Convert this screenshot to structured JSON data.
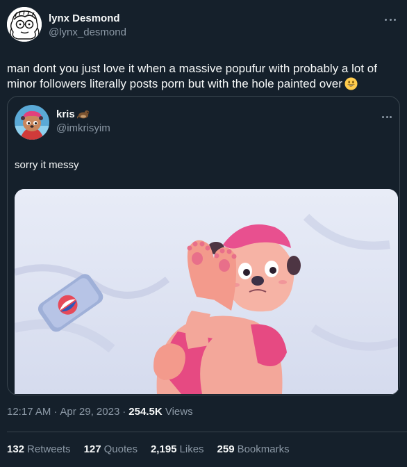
{
  "author": {
    "name": "lynx Desmond",
    "handle": "@lynx_desmond",
    "avatar_icon": "sketch-face-avatar"
  },
  "tweet": {
    "text": "man dont you just love it when a massive popufur with probably a lot of minor followers literally posts porn but with the hole painted over",
    "emoji": "grinning-face-emoji"
  },
  "quote": {
    "name": "kris",
    "name_icon": "otter-emoji",
    "handle": "@imkrisyim",
    "text": "sorry it messy",
    "media_description_icon": "illustration-image"
  },
  "meta": {
    "time": "12:17 AM",
    "separator": "·",
    "date": "Apr 29, 2023",
    "views_count": "254.5K",
    "views_label": "Views"
  },
  "stats": [
    {
      "count": "132",
      "label": "Retweets"
    },
    {
      "count": "127",
      "label": "Quotes"
    },
    {
      "count": "2,195",
      "label": "Likes"
    },
    {
      "count": "259",
      "label": "Bookmarks"
    }
  ],
  "colors": {
    "background": "#15202b",
    "text_primary": "#f7f9f9",
    "text_secondary": "#8b98a5",
    "border": "#38444d"
  }
}
